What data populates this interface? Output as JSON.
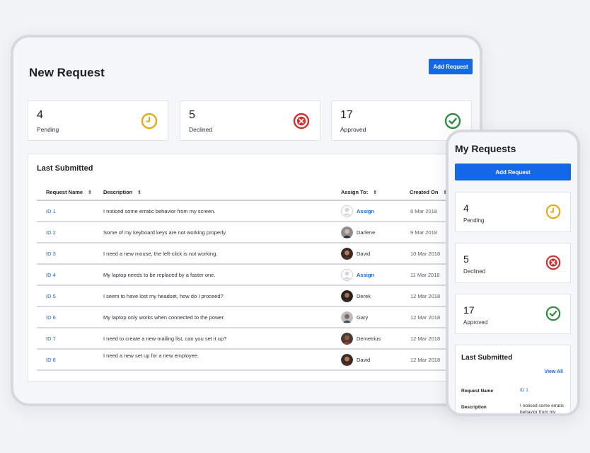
{
  "tablet": {
    "title": "New Request",
    "add_button": "Add Request",
    "stats": [
      {
        "count": "4",
        "label": "Pending",
        "icon": "clock-icon",
        "color": "#e8a810"
      },
      {
        "count": "5",
        "label": "Declined",
        "icon": "x-circle-icon",
        "color": "#d92d2d"
      },
      {
        "count": "17",
        "label": "Approved",
        "icon": "check-circle-icon",
        "color": "#2f8c3e"
      }
    ],
    "table": {
      "title": "Last Submitted",
      "columns": [
        "Request Name",
        "Description",
        "Assign To:",
        "Created On"
      ],
      "rows": [
        {
          "id": "ID 1",
          "description": "I noticed some erratic behavior from my screen.",
          "assignee": "Assign",
          "date": "8 Mar 2018"
        },
        {
          "id": "ID 2",
          "description": "Some of my keyboard keys are not working properly.",
          "assignee": "Darlene",
          "date": "9 Mar 2018"
        },
        {
          "id": "ID 3",
          "description": "I need a new mouse, the left-click is not working.",
          "assignee": "David",
          "date": "10 Mar 2018"
        },
        {
          "id": "ID 4",
          "description": "My laptop needs to be replaced by a faster one.",
          "assignee": "Assign",
          "date": "11 Mar 2018"
        },
        {
          "id": "ID 5",
          "description": "I seem to have lost my headset, how do I proceed?",
          "assignee": "Derek",
          "date": "12 Mar 2018"
        },
        {
          "id": "ID 6",
          "description": "My laptop only works when connected to the power.",
          "assignee": "Gary",
          "date": "12 Mar 2018"
        },
        {
          "id": "ID 7",
          "description": "I need to create a new mailing list, can you set it up?",
          "assignee": "Demetrius",
          "date": "12 Mar 2018"
        },
        {
          "id": "ID 8",
          "description": "I need a new set up for a new employee.",
          "assignee": "David",
          "date": "12 Mar 2018"
        }
      ]
    }
  },
  "phone": {
    "title": "My Requests",
    "add_button": "Add Request",
    "stats": [
      {
        "count": "4",
        "label": "Pending"
      },
      {
        "count": "5",
        "label": "Declined"
      },
      {
        "count": "17",
        "label": "Approved"
      }
    ],
    "list": {
      "title": "Last Submitted",
      "view_all": "View All",
      "request_name_label": "Request Name",
      "request_name_value": "ID 1",
      "description_label": "Description",
      "description_value": "I noticed some erratic behavior from my screen."
    }
  },
  "colors": {
    "accent": "#1468e8",
    "pending": "#e8a810",
    "declined": "#d92d2d",
    "approved": "#2f8c3e"
  }
}
